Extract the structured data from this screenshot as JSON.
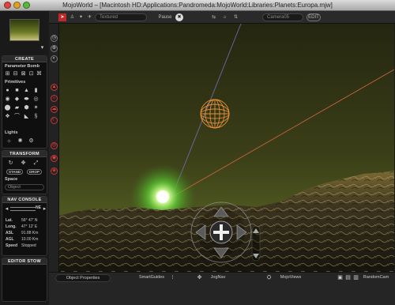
{
  "window": {
    "title": "MojoWorld – [Macintosh HD:Applications:Pandromeda:MojoWorld:Libraries:Planets:Europa.mjw]"
  },
  "toolbar": {
    "render_mode": "Textured",
    "pause_label": "Pause",
    "camera": "Camera05",
    "edit_label": "EDIT"
  },
  "left_panel": {
    "create_header": "CREATE",
    "parameter_bomb_label": "Parameter Bomb",
    "primitives_label": "Primitives",
    "lights_label": "Lights",
    "transform_header": "TRANSFORM",
    "stand_label": "STAND",
    "drop_label": "DROP",
    "space_label": "Space",
    "space_value": "Object",
    "nav_console_header": "NAV CONSOLE",
    "heading_value": "NE",
    "nav": [
      {
        "label": "Lat.",
        "value": "56° 47' N"
      },
      {
        "label": "Long.",
        "value": "47° 12' E"
      },
      {
        "label": "ASL",
        "value": "91.88 Km"
      },
      {
        "label": "AGL",
        "value": "10.00 Km"
      },
      {
        "label": "Speed",
        "value": "Stopped"
      }
    ],
    "editor_stow_header": "EDITOR STOW"
  },
  "bottom_bar": {
    "object_properties": "Object Properties",
    "smart_guides": "SmartGuides",
    "jog_nav": "JogNav",
    "mojo_views": "MojoViews",
    "random_cam": "RandomCam"
  },
  "colors": {
    "sky_top": "#242610",
    "sky_horizon": "#4d5620",
    "sun_glow": "#5fcf35",
    "light_sphere": "#e5903a",
    "axis_blue": "#6a6aa8",
    "axis_red": "#c86440",
    "active_tool": "#c0282a"
  },
  "icons": [
    "select-arrow-icon",
    "walk-icon",
    "run-icon",
    "fly-icon",
    "pause-icon",
    "camera-icon",
    "globe-icon",
    "move-arrows-icon"
  ]
}
